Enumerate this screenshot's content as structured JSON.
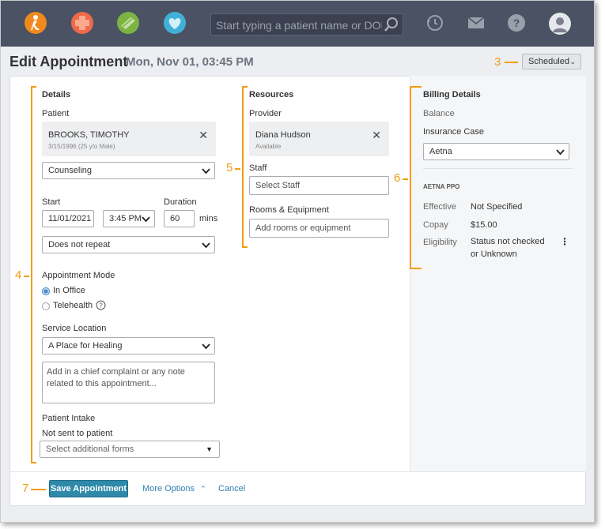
{
  "nav": {
    "search_placeholder": "Start typing a patient name or DOB"
  },
  "header": {
    "title": "Edit Appointment",
    "datetime": "Mon, Nov 01, 03:45 PM",
    "status": "Scheduled"
  },
  "callouts": {
    "status": "3",
    "details": "4",
    "resources": "5",
    "billing": "6",
    "save": "7"
  },
  "details": {
    "section_title": "Details",
    "patient_label": "Patient",
    "patient_name": "BROOKS, TIMOTHY",
    "patient_info": "3/15/1996 (25 y/o Male)",
    "appointment_type": "Counseling",
    "start_label": "Start",
    "duration_label": "Duration",
    "date": "11/01/2021",
    "time": "3:45 PM",
    "duration": "60",
    "duration_unit": "mins",
    "repeat": "Does not repeat",
    "mode_label": "Appointment Mode",
    "mode_options": [
      "In Office",
      "Telehealth"
    ],
    "service_location_label": "Service Location",
    "service_location": "A Place for Healing",
    "notes_placeholder": "Add in a chief complaint or any note related to this appointment...",
    "intake_label": "Patient Intake",
    "intake_status": "Not sent to patient",
    "forms_placeholder": "Select additional forms"
  },
  "resources": {
    "section_title": "Resources",
    "provider_label": "Provider",
    "provider_name": "Diana Hudson",
    "provider_status": "Available",
    "staff_label": "Staff",
    "staff_placeholder": "Select Staff",
    "rooms_label": "Rooms & Equipment",
    "rooms_placeholder": "Add rooms or equipment"
  },
  "billing": {
    "section_title": "Billing Details",
    "balance_label": "Balance",
    "insurance_label": "Insurance Case",
    "insurance": "Aetna",
    "plan": "AETNA PPO",
    "rows": [
      {
        "label": "Effective",
        "value": "Not Specified"
      },
      {
        "label": "Copay",
        "value": "$15.00"
      },
      {
        "label": "Eligibility",
        "value": "Status not checked or Unknown"
      }
    ]
  },
  "footer": {
    "save_label": "Save Appointment",
    "more_label": "More Options",
    "cancel_label": "Cancel"
  },
  "colors": {
    "accent": "#2f89a8",
    "callout": "#f39c12",
    "nav_bg": "#4b5263"
  }
}
